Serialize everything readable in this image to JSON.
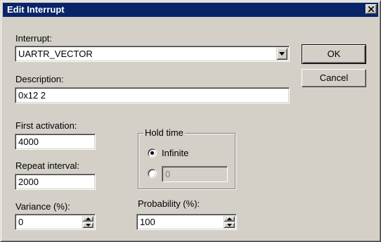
{
  "window": {
    "title": "Edit Interrupt"
  },
  "interrupt": {
    "label": "Interrupt:",
    "value": "UARTR_VECTOR"
  },
  "description": {
    "label": "Description:",
    "value": "0x12 2"
  },
  "first_activation": {
    "label": "First activation:",
    "value": "4000"
  },
  "repeat_interval": {
    "label": "Repeat interval:",
    "value": "2000"
  },
  "variance": {
    "label": "Variance (%):",
    "value": "0"
  },
  "hold_time": {
    "label": "Hold time",
    "infinite_label": "Infinite",
    "selected": "infinite",
    "custom_value": "0"
  },
  "probability": {
    "label": "Probability (%):",
    "value": "100"
  },
  "buttons": {
    "ok": "OK",
    "cancel": "Cancel"
  },
  "icons": {
    "close": "close-icon",
    "dropdown": "chevron-down-icon",
    "spin_up": "arrow-up-icon",
    "spin_down": "arrow-down-icon"
  },
  "colors": {
    "titlebar": "#0a246a",
    "face": "#d4d0c8"
  }
}
